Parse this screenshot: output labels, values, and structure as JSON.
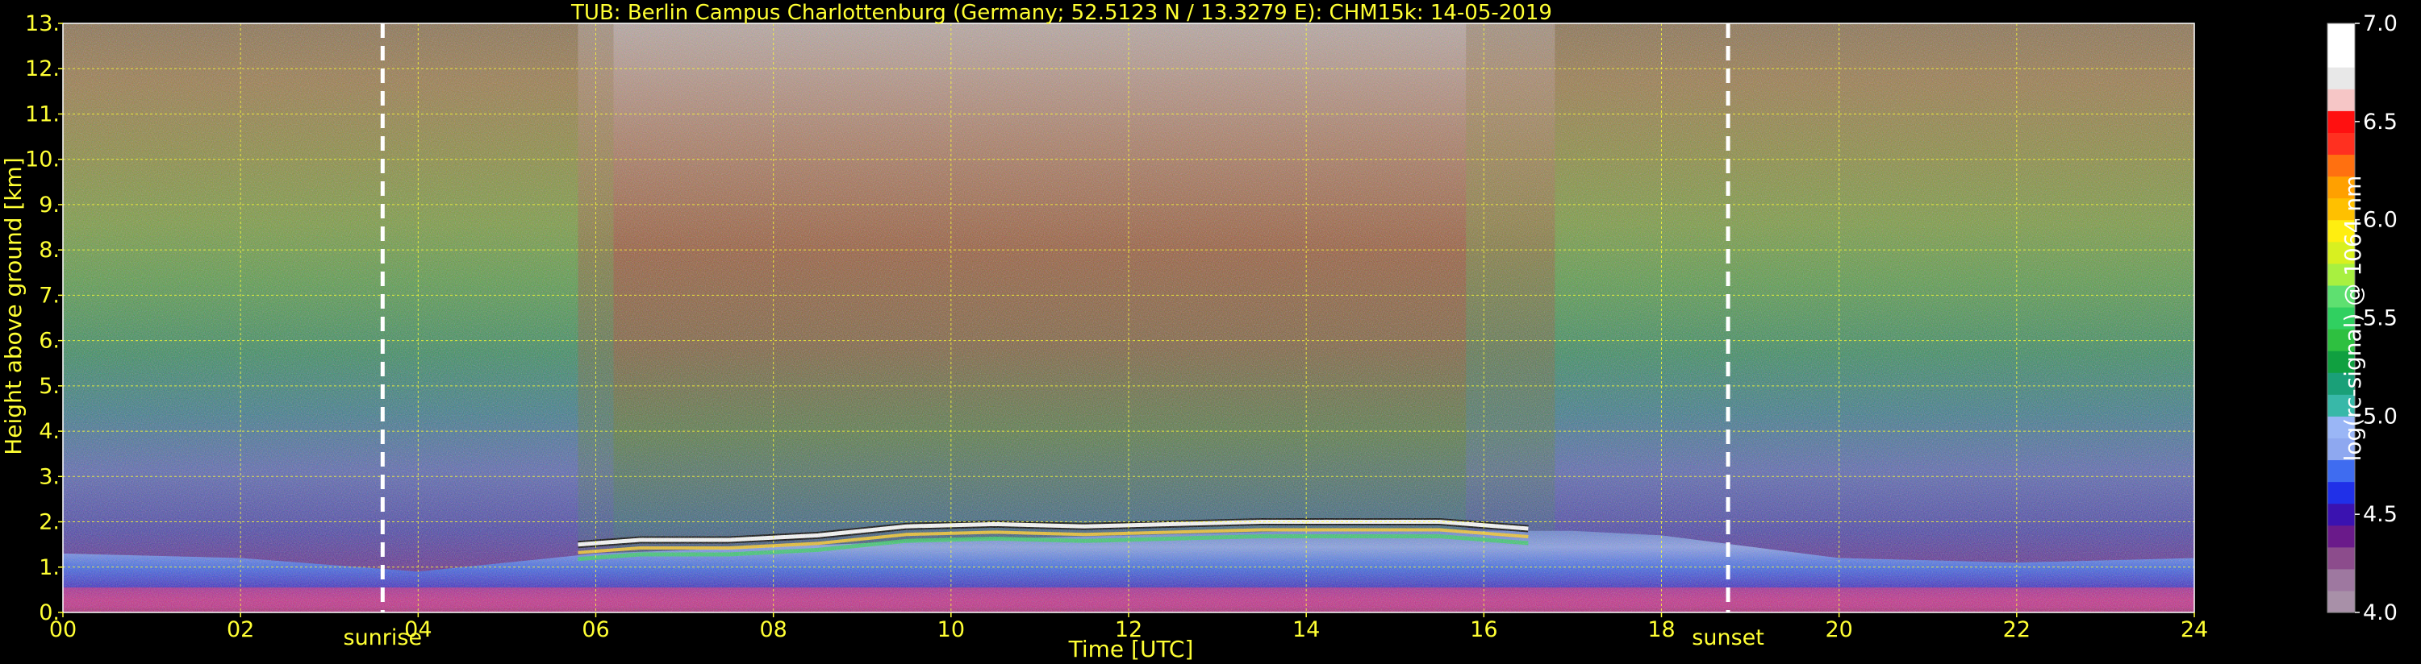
{
  "chart_data": {
    "type": "heatmap",
    "title": "TUB: Berlin Campus Charlottenburg (Germany; 52.5123 N / 13.3279 E):    CHM15k: 14-05-2019",
    "xlabel": "Time [UTC]",
    "ylabel": "Height above ground [km]",
    "xlim": [
      0,
      24
    ],
    "ylim": [
      0,
      13
    ],
    "x_ticks": [
      "00",
      "02",
      "04",
      "06",
      "08",
      "10",
      "12",
      "14",
      "16",
      "18",
      "20",
      "22",
      "24"
    ],
    "y_ticks": [
      "0.",
      "1.",
      "2.",
      "3.",
      "4.",
      "5.",
      "6.",
      "7.",
      "8.",
      "9.",
      "10.",
      "11.",
      "12.",
      "13."
    ],
    "grid": true,
    "events": [
      {
        "label": "sunrise",
        "x": 3.6
      },
      {
        "label": "sunset",
        "x": 18.75
      }
    ],
    "colorbar": {
      "label": "log(rc-signal) @ 1064 nm",
      "range": [
        4.0,
        7.0
      ],
      "ticks": [
        "4.0",
        "4.5",
        "5.0",
        "5.5",
        "6.0",
        "6.5",
        "7.0"
      ]
    },
    "cloud_top_km": [
      {
        "x": 5.8,
        "y": 1.5
      },
      {
        "x": 6.5,
        "y": 1.6
      },
      {
        "x": 7.5,
        "y": 1.6
      },
      {
        "x": 8.5,
        "y": 1.7
      },
      {
        "x": 9.5,
        "y": 1.9
      },
      {
        "x": 10.5,
        "y": 1.95
      },
      {
        "x": 11.5,
        "y": 1.9
      },
      {
        "x": 12.5,
        "y": 1.95
      },
      {
        "x": 13.5,
        "y": 2.0
      },
      {
        "x": 14.5,
        "y": 2.0
      },
      {
        "x": 15.5,
        "y": 2.0
      },
      {
        "x": 16.5,
        "y": 1.85
      }
    ],
    "boundary_layer_top_km": [
      {
        "x": 0,
        "y": 1.3
      },
      {
        "x": 2,
        "y": 1.2
      },
      {
        "x": 4,
        "y": 0.9
      },
      {
        "x": 6,
        "y": 1.3
      },
      {
        "x": 10,
        "y": 1.6
      },
      {
        "x": 14,
        "y": 1.8
      },
      {
        "x": 17,
        "y": 1.8
      },
      {
        "x": 18,
        "y": 1.7
      },
      {
        "x": 20,
        "y": 1.2
      },
      {
        "x": 22,
        "y": 1.1
      },
      {
        "x": 24,
        "y": 1.2
      }
    ]
  },
  "colors": {
    "axis_text": "#ffff33",
    "grid": "#ffff33",
    "background": "#000000",
    "colormap": [
      "#a890a8",
      "#9e78a0",
      "#8c4c8c",
      "#6a1a8a",
      "#3a12b0",
      "#2030e8",
      "#3f6cf0",
      "#8ea8f0",
      "#9ab6f6",
      "#38b8a8",
      "#1aa078",
      "#10a040",
      "#2ec040",
      "#30d060",
      "#5ee070",
      "#a8f040",
      "#d8f020",
      "#ffee10",
      "#ffc000",
      "#ffa000",
      "#ff7010",
      "#ff3020",
      "#ff1010",
      "#f6c6c6",
      "#e8e8e8",
      "#ffffff",
      "#ffffff"
    ]
  }
}
